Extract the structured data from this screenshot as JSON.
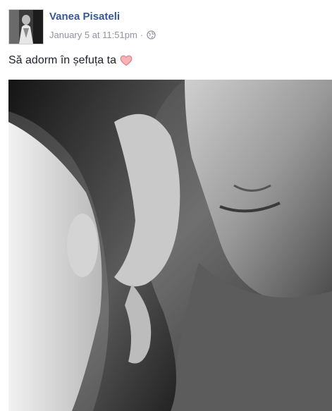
{
  "post": {
    "author": "Vanea Pisateli",
    "timestamp": "January 5 at 11:51pm",
    "separator": "·",
    "audience_icon": "globe-icon",
    "text": "Să adorm în șefuța ta",
    "emoji": "heart-icon",
    "emoji_color": "#f4a7a9",
    "photo_subject": "black-and-white photo of a man holding a woman's head close",
    "link_color": "#365899",
    "meta_color": "#90949c"
  }
}
